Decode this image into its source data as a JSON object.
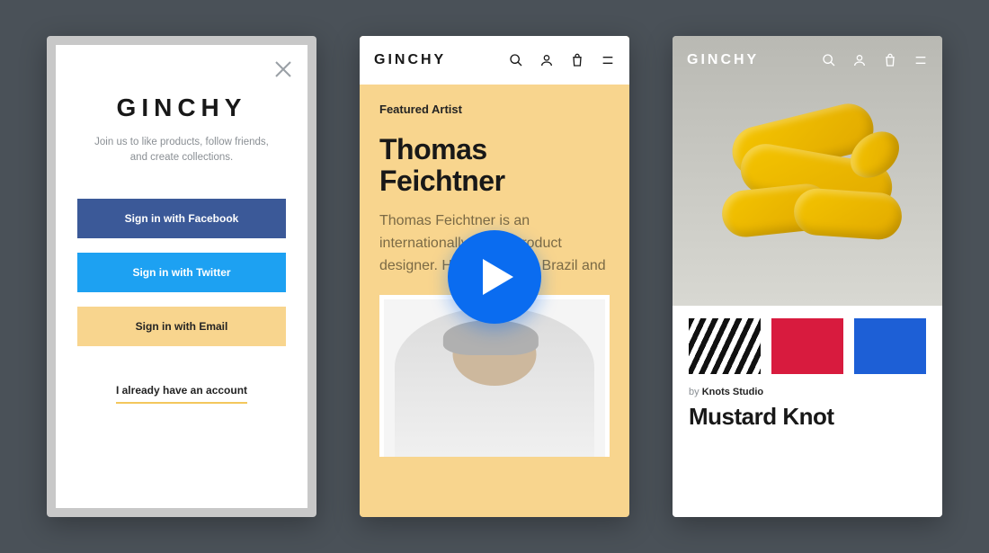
{
  "brand": "GINCHY",
  "screen1": {
    "tagline": "Join us to like products, follow friends, and create collections.",
    "btn_facebook": "Sign in with Facebook",
    "btn_twitter": "Sign in with Twitter",
    "btn_email": "Sign in with Email",
    "already_have": "I already have an account"
  },
  "screen2": {
    "eyebrow": "Featured Artist",
    "artist_name": "Thomas Feichtner",
    "artist_desc": "Thomas Feichtner is an internationally active product designer. He was born in Brazil and"
  },
  "screen3": {
    "by_prefix": "by",
    "studio": "Knots Studio",
    "product": "Mustard Knot"
  }
}
